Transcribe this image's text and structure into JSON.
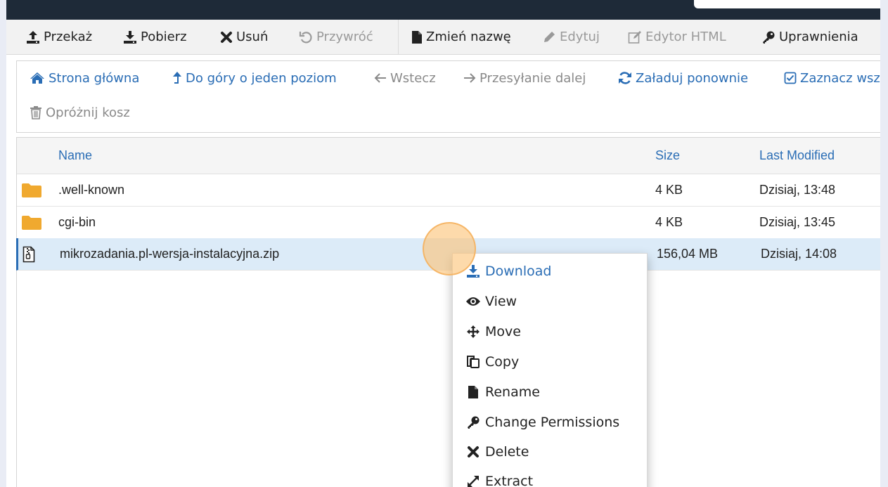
{
  "toolbar": {
    "items": [
      {
        "label": "Przekaż",
        "icon": "upload-icon",
        "enabled": true
      },
      {
        "label": "Pobierz",
        "icon": "download-icon",
        "enabled": true
      },
      {
        "label": "Usuń",
        "icon": "close-icon",
        "enabled": true
      },
      {
        "label": "Przywróć",
        "icon": "undo-icon",
        "enabled": false
      },
      {
        "label": "Zmień nazwę",
        "icon": "file-icon",
        "enabled": true
      },
      {
        "label": "Edytuj",
        "icon": "pencil-icon",
        "enabled": false
      },
      {
        "label": "Edytor HTML",
        "icon": "edit-square-icon",
        "enabled": false
      },
      {
        "label": "Uprawnienia",
        "icon": "key-icon",
        "enabled": true
      }
    ]
  },
  "navbar": {
    "items": [
      {
        "label": "Strona główna",
        "icon": "home-icon",
        "enabled": true
      },
      {
        "label": "Do góry o jeden poziom",
        "icon": "level-up-icon",
        "enabled": true
      },
      {
        "label": "Wstecz",
        "icon": "arrow-left-icon",
        "enabled": false
      },
      {
        "label": "Przesyłanie dalej",
        "icon": "arrow-right-icon",
        "enabled": false
      },
      {
        "label": "Załaduj ponownie",
        "icon": "refresh-icon",
        "enabled": true
      },
      {
        "label": "Zaznacz wsz",
        "icon": "checkbox-icon",
        "enabled": true
      },
      {
        "label": "Opróżnij kosz",
        "icon": "trash-icon",
        "enabled": false
      }
    ]
  },
  "table": {
    "columns": {
      "name": "Name",
      "size": "Size",
      "modified": "Last Modified"
    },
    "rows": [
      {
        "name": ".well-known",
        "size": "4 KB",
        "modified": "Dzisiaj, 13:48",
        "type": "folder",
        "selected": false
      },
      {
        "name": "cgi-bin",
        "size": "4 KB",
        "modified": "Dzisiaj, 13:45",
        "type": "folder",
        "selected": false
      },
      {
        "name": "mikrozadania.pl-wersja-instalacyjna.zip",
        "size": "156,04 MB",
        "modified": "Dzisiaj, 14:08",
        "type": "archive",
        "selected": true
      }
    ]
  },
  "context_menu": {
    "items": [
      {
        "label": "Download",
        "icon": "download-icon"
      },
      {
        "label": "View",
        "icon": "eye-icon"
      },
      {
        "label": "Move",
        "icon": "move-icon"
      },
      {
        "label": "Copy",
        "icon": "copy-icon"
      },
      {
        "label": "Rename",
        "icon": "file-icon"
      },
      {
        "label": "Change Permissions",
        "icon": "key-icon"
      },
      {
        "label": "Delete",
        "icon": "close-icon"
      },
      {
        "label": "Extract",
        "icon": "expand-icon"
      }
    ]
  },
  "colors": {
    "link": "#2a6db5",
    "selected_row": "#dcebf8",
    "folder": "#f0a92f",
    "header_bar": "#1e2a38",
    "click_marker": "#fcc478"
  }
}
